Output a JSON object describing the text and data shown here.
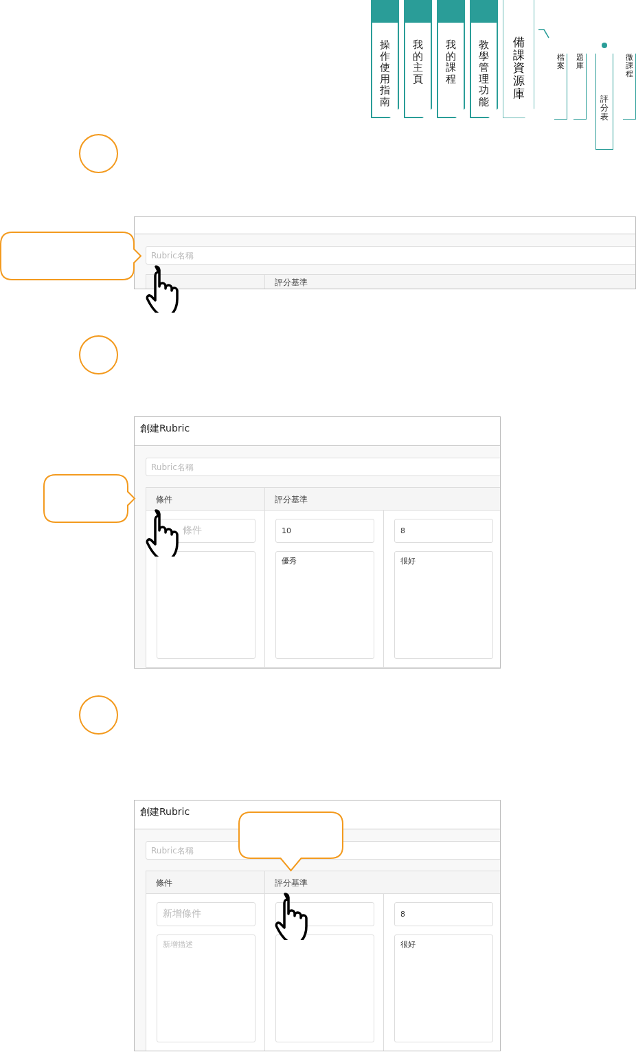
{
  "nav_tabs": [
    {
      "label": "操作使用指南",
      "selected": false
    },
    {
      "label": "我的主頁",
      "selected": false
    },
    {
      "label": "我的課程",
      "selected": false
    },
    {
      "label": "教學管理功能",
      "selected": false
    },
    {
      "label": "備課資源庫",
      "selected": true
    }
  ],
  "sub_tabs": [
    {
      "label": "檔案",
      "selected": false
    },
    {
      "label": "題庫",
      "selected": false
    },
    {
      "label": "評分表",
      "selected": true
    },
    {
      "label": "微課程",
      "selected": false
    }
  ],
  "steps": [
    {
      "kind": "name_field",
      "panel": {
        "name_placeholder": "Rubric名稱",
        "headers": [
          {
            "kind": "criterion"
          },
          {
            "kind": "scale",
            "label": "評分基準"
          }
        ]
      }
    },
    {
      "kind": "criterion_header",
      "panel": {
        "title": "創建Rubric",
        "name_placeholder": "Rubric名稱",
        "headers": [
          {
            "kind": "criterion",
            "label": "條件"
          },
          {
            "kind": "scale",
            "label": "評分基準"
          }
        ],
        "cells": [
          {
            "kind": "criterion",
            "title_placeholder": "條件",
            "partially_covered": true
          },
          {
            "kind": "level",
            "score": "10",
            "description": "優秀"
          },
          {
            "kind": "level",
            "score": "8",
            "description": "很好"
          }
        ]
      }
    },
    {
      "kind": "scale_header",
      "panel": {
        "title": "創建Rubric",
        "name_placeholder": "Rubric名稱",
        "headers": [
          {
            "kind": "criterion",
            "label": "條件"
          },
          {
            "kind": "scale",
            "label": "評分基準"
          }
        ],
        "cells": [
          {
            "kind": "criterion",
            "title_placeholder": "新增條件",
            "description_placeholder": "新增描述",
            "partially_covered": false
          },
          {
            "kind": "level"
          },
          {
            "kind": "level",
            "score": "8",
            "description": "很好"
          }
        ]
      }
    }
  ]
}
